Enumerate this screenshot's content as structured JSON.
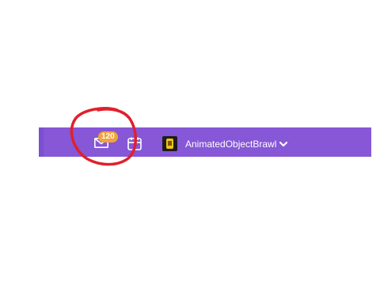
{
  "toolbar": {
    "messages_badge": "120",
    "messages_icon": "mail-icon",
    "calendar_icon": "calendar-icon",
    "game": {
      "name": "AnimatedObjectBrawl",
      "thumbnail_icon": "game-thumbnail",
      "dropdown_icon": "chevron-down-icon"
    }
  },
  "colors": {
    "bar": "#8657d6",
    "badge": "#f2a33a",
    "annotation": "#e0202b"
  }
}
